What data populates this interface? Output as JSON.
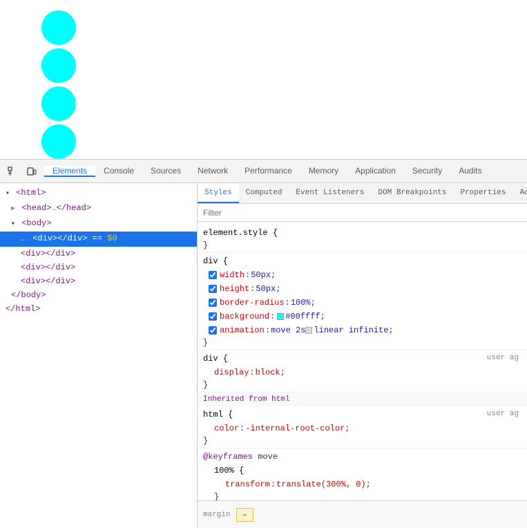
{
  "page": {
    "circles": [
      {
        "id": "circle-1",
        "color": "#00ffff"
      },
      {
        "id": "circle-2",
        "color": "#00ffff"
      },
      {
        "id": "circle-3",
        "color": "#00ffff"
      },
      {
        "id": "circle-4",
        "color": "#00ffff"
      }
    ]
  },
  "devtools": {
    "tabs": [
      {
        "id": "elements",
        "label": "Elements",
        "active": true
      },
      {
        "id": "console",
        "label": "Console",
        "active": false
      },
      {
        "id": "sources",
        "label": "Sources",
        "active": false
      },
      {
        "id": "network",
        "label": "Network",
        "active": false
      },
      {
        "id": "performance",
        "label": "Performance",
        "active": false
      },
      {
        "id": "memory",
        "label": "Memory",
        "active": false
      },
      {
        "id": "application",
        "label": "Application",
        "active": false
      },
      {
        "id": "security",
        "label": "Security",
        "active": false
      },
      {
        "id": "audits",
        "label": "Audits",
        "active": false
      }
    ],
    "html_tree": {
      "lines": [
        {
          "text": "<html>",
          "type": "tag",
          "indent": 0,
          "selected": false
        },
        {
          "text": "<head>…</head>",
          "type": "tag-collapsed",
          "indent": 1,
          "selected": false
        },
        {
          "text": "<body>",
          "type": "tag",
          "indent": 1,
          "selected": false
        },
        {
          "text": "<div></div> == $0",
          "type": "tag-selected",
          "indent": 2,
          "selected": true
        },
        {
          "text": "<div></div>",
          "type": "tag",
          "indent": 2,
          "selected": false
        },
        {
          "text": "<div></div>",
          "type": "tag",
          "indent": 2,
          "selected": false
        },
        {
          "text": "<div></div>",
          "type": "tag",
          "indent": 2,
          "selected": false
        },
        {
          "text": "</body>",
          "type": "close-tag",
          "indent": 1,
          "selected": false
        },
        {
          "text": "</html>",
          "type": "close-tag",
          "indent": 0,
          "selected": false
        }
      ]
    },
    "styles_tabs": [
      {
        "id": "styles",
        "label": "Styles",
        "active": true
      },
      {
        "id": "computed",
        "label": "Computed",
        "active": false
      },
      {
        "id": "event-listeners",
        "label": "Event Listeners",
        "active": false
      },
      {
        "id": "dom-breakpoints",
        "label": "DOM Breakpoints",
        "active": false
      },
      {
        "id": "properties",
        "label": "Properties",
        "active": false
      },
      {
        "id": "accessibility",
        "label": "Ac",
        "active": false
      }
    ],
    "filter_placeholder": "Filter",
    "css_rules": [
      {
        "selector": "element.style {",
        "close": "}",
        "props": []
      },
      {
        "selector": "div {",
        "close": "}",
        "props": [
          {
            "checked": true,
            "name": "width",
            "value": "50px"
          },
          {
            "checked": true,
            "name": "height",
            "value": "50px"
          },
          {
            "checked": true,
            "name": "border-radius",
            "value": "100%"
          },
          {
            "checked": true,
            "name": "background",
            "value": "#00ffff",
            "has_color": true,
            "color": "#00ffff"
          },
          {
            "checked": true,
            "name": "animation",
            "value": "move 2s",
            "has_checkbox_extra": true,
            "extra": "linear infinite"
          }
        ]
      },
      {
        "selector": "div {",
        "source": "user ag",
        "close": "}",
        "props": [
          {
            "name": "display",
            "value": "block",
            "is_indented": true
          }
        ]
      }
    ],
    "inherited_label": "Inherited from",
    "inherited_tag": "html",
    "html_rule": {
      "selector": "html {",
      "source": "user ag",
      "close": "}",
      "props": [
        {
          "name": "color",
          "value": "-internal-root-color",
          "is_indented": true
        }
      ]
    },
    "keyframes": {
      "label": "@keyframes move",
      "frames": [
        {
          "selector": "100% {",
          "close": "}",
          "props": [
            {
              "name": "transform",
              "value": "translate(300%, 0)",
              "is_indented": true
            }
          ]
        }
      ]
    },
    "box_model": {
      "label": "margin",
      "dash": "–"
    }
  }
}
